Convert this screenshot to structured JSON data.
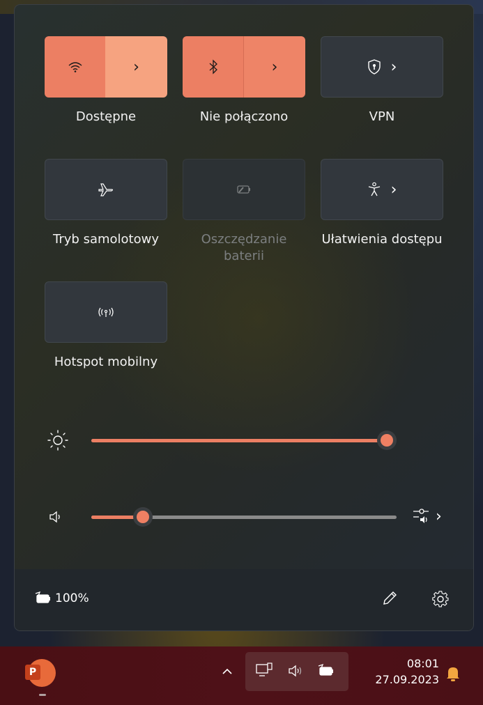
{
  "tiles": [
    {
      "id": "wifi",
      "label": "Dostępne",
      "active": true
    },
    {
      "id": "bluetooth",
      "label": "Nie połączono",
      "active": true
    },
    {
      "id": "vpn",
      "label": "VPN",
      "active": false
    },
    {
      "id": "airplane",
      "label": "Tryb samolotowy",
      "active": false
    },
    {
      "id": "battery-saver",
      "label": "Oszczędzanie baterii",
      "active": false,
      "disabled": true
    },
    {
      "id": "accessibility",
      "label": "Ułatwienia dostępu",
      "active": false
    },
    {
      "id": "hotspot",
      "label": "Hotspot mobilny",
      "active": false
    }
  ],
  "brightness": {
    "level": 1.0,
    "icon": "sun-icon"
  },
  "volume": {
    "level": 0.17,
    "icon": "speaker-icon"
  },
  "footer": {
    "battery_text": "100%"
  },
  "taskbar": {
    "app_icon": "powerpoint-icon",
    "app_letter": "P",
    "time": "08:01",
    "date": "27.09.2023"
  },
  "colors": {
    "accent": "#ec7f63",
    "accent_light": "#f6a380",
    "taskbar": "#4e1118"
  }
}
